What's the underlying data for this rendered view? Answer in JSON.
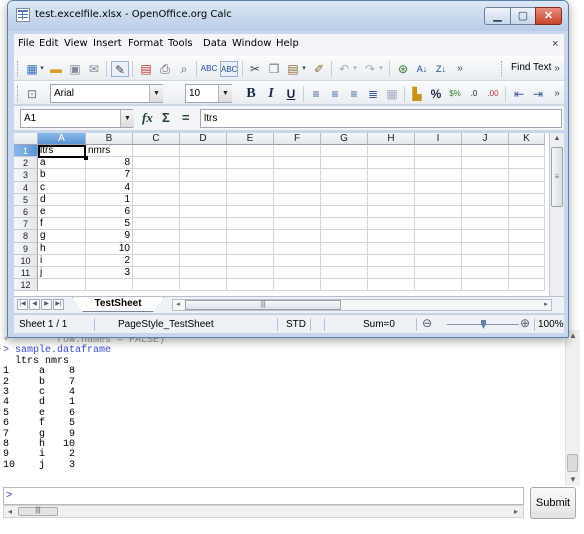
{
  "window": {
    "title": "test.excelfile.xlsx - OpenOffice.org Calc",
    "btn_min": "▁",
    "btn_max": "▢",
    "btn_close": "✕"
  },
  "menu": {
    "items": [
      "File",
      "Edit",
      "View",
      "Insert",
      "Format",
      "Tools",
      "Data",
      "Window",
      "Help"
    ],
    "close": "×"
  },
  "toolbar1": {
    "icons": [
      "new-document-icon",
      "open-folder-icon",
      "save-icon",
      "email-icon",
      "edit-file-icon",
      "export-pdf-icon",
      "print-icon",
      "print-preview-icon",
      "spellcheck-icon",
      "autospellcheck-icon",
      "cut-icon",
      "copy-icon",
      "paste-icon",
      "format-paintbrush-icon",
      "undo-icon",
      "redo-icon",
      "hyperlink-icon",
      "sort-ascending-icon",
      "sort-descending-icon"
    ],
    "find_text": "Find Text"
  },
  "toolbar2": {
    "font_name": "Arial",
    "font_size": "10",
    "bold": "B",
    "italic": "I",
    "underline": "U",
    "percent": "%",
    "currency": "$%",
    "dec_add": ".0",
    "dec_del": ".00"
  },
  "formula": {
    "cell_ref": "A1",
    "fx": "fx",
    "sum": "Σ",
    "equals": "=",
    "value": "ltrs"
  },
  "grid": {
    "columns": [
      "A",
      "B",
      "C",
      "D",
      "E",
      "F",
      "G",
      "H",
      "I",
      "J",
      "K"
    ],
    "selected_col": "A",
    "rows": [
      {
        "n": "1",
        "a": "ltrs",
        "b": "nmrs"
      },
      {
        "n": "2",
        "a": "a",
        "b": "8"
      },
      {
        "n": "3",
        "a": "b",
        "b": "7"
      },
      {
        "n": "4",
        "a": "c",
        "b": "4"
      },
      {
        "n": "5",
        "a": "d",
        "b": "1"
      },
      {
        "n": "6",
        "a": "e",
        "b": "6"
      },
      {
        "n": "7",
        "a": "f",
        "b": "5"
      },
      {
        "n": "8",
        "a": "g",
        "b": "9"
      },
      {
        "n": "9",
        "a": "h",
        "b": "10"
      },
      {
        "n": "10",
        "a": "i",
        "b": "2"
      },
      {
        "n": "11",
        "a": "j",
        "b": "3"
      },
      {
        "n": "12",
        "a": "",
        "b": ""
      }
    ]
  },
  "tabs": {
    "sheet_name": "TestSheet"
  },
  "status": {
    "sheet": "Sheet 1 / 1",
    "page_style": "PageStyle_TestSheet",
    "mode": "STD",
    "sum": "Sum=0",
    "zoom": "100%",
    "zoom_minus": "⊖",
    "zoom_plus": "⊕"
  },
  "console": {
    "faded_line": "+        row.names = FALSE)",
    "command": "> sample.dataframe",
    "header": "  ltrs nmrs",
    "rows": [
      "1     a    8",
      "2     b    7",
      "3     c    4",
      "4     d    1",
      "5     e    6",
      "6     f    5",
      "7     g    9",
      "8     h   10",
      "9     i    2",
      "10    j    3"
    ],
    "prompt": ">",
    "submit": "Submit",
    "hthumb": "|||"
  }
}
